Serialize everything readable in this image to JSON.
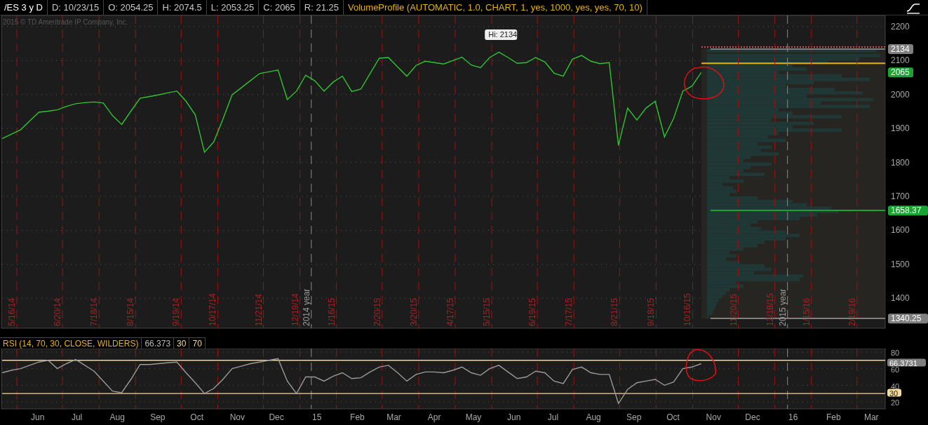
{
  "header": {
    "fields": [
      {
        "kind": "symbol",
        "text": "/ES 3 y D"
      },
      {
        "kind": "field",
        "text": "D: 10/23/15"
      },
      {
        "kind": "field",
        "text": "O: 2054.25"
      },
      {
        "kind": "field",
        "text": "H: 2074.5"
      },
      {
        "kind": "field",
        "text": "L: 2053.25"
      },
      {
        "kind": "field",
        "text": "C: 2065"
      },
      {
        "kind": "field",
        "text": "R: 21.25"
      },
      {
        "kind": "study",
        "text": "VolumeProfile (AUTOMATIC, 1.0, CHART, 1, yes, 1000, yes, yes, 70, 10)"
      }
    ]
  },
  "copyright": "2015 © TD Ameritrade IP Company, Inc.",
  "high_label": "Hi: 2134",
  "period_markers": [
    {
      "kind": "period",
      "label": "5/16/14"
    },
    {
      "kind": "period",
      "label": "6/20/14"
    },
    {
      "kind": "period",
      "label": "7/18/14"
    },
    {
      "kind": "period",
      "label": "8/15/14"
    },
    {
      "kind": "period",
      "label": "9/19/14"
    },
    {
      "kind": "period",
      "label": "10/17/14"
    },
    {
      "kind": "period",
      "label": "11/21/14"
    },
    {
      "kind": "period",
      "label": "12/19/14"
    },
    {
      "kind": "year",
      "label": "2014 year"
    },
    {
      "kind": "period",
      "label": "1/16/15"
    },
    {
      "kind": "period",
      "label": "2/20/15"
    },
    {
      "kind": "period",
      "label": "3/20/15"
    },
    {
      "kind": "period",
      "label": "4/17/15"
    },
    {
      "kind": "period",
      "label": "5/15/15"
    },
    {
      "kind": "period",
      "label": "6/19/15"
    },
    {
      "kind": "period",
      "label": "7/17/15"
    },
    {
      "kind": "period",
      "label": "8/21/15"
    },
    {
      "kind": "period",
      "label": "9/18/15"
    },
    {
      "kind": "period",
      "label": "10/16/15"
    },
    {
      "kind": "period",
      "label": "11/20/15"
    },
    {
      "kind": "period",
      "label": "12/18/15"
    },
    {
      "kind": "year",
      "label": "2015 year"
    },
    {
      "kind": "period",
      "label": "1/15/16"
    },
    {
      "kind": "period",
      "label": "2/19/16"
    }
  ],
  "price_levels": [
    {
      "label": "2134",
      "color": "#7f7f7f"
    },
    {
      "label": "2065",
      "color": "#1aa532"
    },
    {
      "label": "1658.37",
      "color": "#1aa532"
    },
    {
      "label": "1340.25",
      "color": "#7f7f7f"
    }
  ],
  "price_chart": {
    "chart_data": {
      "type": "line",
      "grid": true,
      "ylim": [
        1311.6,
        2233
      ],
      "yticks": [
        1400,
        1500,
        1600,
        1700,
        1800,
        1900,
        2000,
        2100,
        2200
      ],
      "series": [
        {
          "color": "#2fc42f",
          "values": [
            1870,
            1883,
            1896,
            1922,
            1948,
            1951,
            1955,
            1965,
            1973,
            1976,
            1978,
            1975,
            1938,
            1912,
            1951,
            1989,
            1994,
            1999,
            2005,
            2010,
            1980,
            1940,
            1830,
            1860,
            1927,
            1999,
            2020,
            2041,
            2062,
            2067,
            2072,
            1985,
            2010,
            2057,
            2040,
            2010,
            2037,
            2054,
            2009,
            2016,
            2062,
            2107,
            2109,
            2081,
            2054,
            2086,
            2098,
            2094,
            2090,
            2100,
            2110,
            2087,
            2079,
            2109,
            2125,
            2109,
            2092,
            2094,
            2109,
            2096,
            2063,
            2054,
            2104,
            2115,
            2098,
            2091,
            2094,
            1850,
            1960,
            1925,
            1960,
            1980,
            1875,
            1930,
            2010,
            2025,
            2065,
            null,
            null,
            null,
            null,
            null,
            null,
            null,
            null,
            null,
            null,
            null,
            null,
            null,
            null,
            null,
            null,
            null,
            null,
            null,
            null
          ]
        },
        {
          "color": "#7f7f7f",
          "values": [
            null,
            null,
            null,
            null,
            null,
            null,
            null,
            null,
            null,
            null,
            null,
            null,
            null,
            null,
            null,
            null,
            null,
            null,
            null,
            null,
            null,
            null,
            null,
            null,
            null,
            null,
            null,
            null,
            null,
            null,
            null,
            null,
            null,
            null,
            null,
            null,
            null,
            null,
            null,
            null,
            null,
            null,
            null,
            null,
            null,
            null,
            null,
            null,
            null,
            null,
            null,
            null,
            null,
            null,
            null,
            null,
            null,
            null,
            null,
            null,
            null,
            null,
            null,
            null,
            null,
            null,
            null,
            null,
            null,
            null,
            null,
            null,
            null,
            null,
            null,
            null,
            null,
            2134,
            2134,
            2134,
            2134,
            2134,
            2134,
            2134,
            2134,
            2134,
            2134,
            2134,
            2134,
            2134,
            2134,
            2134,
            2134,
            2134,
            2134,
            2134,
            2134
          ]
        },
        {
          "color": "#1aa532",
          "values": [
            null,
            null,
            null,
            null,
            null,
            null,
            null,
            null,
            null,
            null,
            null,
            null,
            null,
            null,
            null,
            null,
            null,
            null,
            null,
            null,
            null,
            null,
            null,
            null,
            null,
            null,
            null,
            null,
            null,
            null,
            null,
            null,
            null,
            null,
            null,
            null,
            null,
            null,
            null,
            null,
            null,
            null,
            null,
            null,
            null,
            null,
            null,
            null,
            null,
            null,
            null,
            null,
            null,
            null,
            null,
            null,
            null,
            null,
            null,
            null,
            null,
            null,
            null,
            null,
            null,
            null,
            null,
            null,
            null,
            null,
            null,
            null,
            null,
            null,
            null,
            null,
            null,
            1658.37,
            1658.37,
            1658.37,
            1658.37,
            1658.37,
            1658.37,
            1658.37,
            1658.37,
            1658.37,
            1658.37,
            1658.37,
            1658.37,
            1658.37,
            1658.37,
            1658.37,
            1658.37,
            1658.37,
            1658.37,
            1658.37,
            1658.37
          ]
        },
        {
          "color": "#7f7f7f",
          "values": [
            null,
            null,
            null,
            null,
            null,
            null,
            null,
            null,
            null,
            null,
            null,
            null,
            null,
            null,
            null,
            null,
            null,
            null,
            null,
            null,
            null,
            null,
            null,
            null,
            null,
            null,
            null,
            null,
            null,
            null,
            null,
            null,
            null,
            null,
            null,
            null,
            null,
            null,
            null,
            null,
            null,
            null,
            null,
            null,
            null,
            null,
            null,
            null,
            null,
            null,
            null,
            null,
            null,
            null,
            null,
            null,
            null,
            null,
            null,
            null,
            null,
            null,
            null,
            null,
            null,
            null,
            null,
            null,
            null,
            null,
            null,
            null,
            null,
            null,
            null,
            null,
            null,
            1340.25,
            1340.25,
            1340.25,
            1340.25,
            1340.25,
            1340.25,
            1340.25,
            1340.25,
            1340.25,
            1340.25,
            1340.25,
            1340.25,
            1340.25,
            1340.25,
            1340.25,
            1340.25,
            1340.25,
            1340.25,
            1340.25,
            1340.25
          ]
        }
      ]
    }
  },
  "rsi": {
    "header": [
      {
        "kind": "study",
        "text": "RSI (14, 70, 30, CLOSE, WILDERS)"
      },
      {
        "kind": "value",
        "text": "66.373"
      },
      {
        "kind": "threshold",
        "text": "30"
      },
      {
        "kind": "threshold",
        "text": "70"
      }
    ],
    "levels": [
      {
        "label": "66.3731",
        "color": "#7f7f7f"
      },
      {
        "label": "30",
        "color": "#f3dc9a"
      }
    ],
    "month_labels": [
      "Jun",
      "Jul",
      "Aug",
      "Sep",
      "Oct",
      "Nov",
      "Dec",
      "15",
      "Feb",
      "Mar",
      "Apr",
      "May",
      "Jun",
      "Jul",
      "Aug",
      "Sep",
      "Oct",
      "Nov",
      "Dec",
      "16",
      "Feb",
      "Mar"
    ],
    "chart_data": {
      "type": "line",
      "grid": true,
      "ylim": [
        11.5,
        84.2
      ],
      "yticks": [
        20,
        40,
        60,
        80
      ],
      "series": [
        {
          "color": "#efd890",
          "values": [
            70,
            70,
            70,
            70,
            70,
            70,
            70,
            70,
            70,
            70,
            70,
            70,
            70,
            70,
            70,
            70,
            70,
            70,
            70,
            70,
            70,
            70,
            70,
            70,
            70,
            70,
            70,
            70,
            70,
            70,
            70,
            70,
            70,
            70,
            70,
            70,
            70,
            70,
            70,
            70,
            70,
            70,
            70,
            70,
            70,
            70,
            70,
            70,
            70,
            70,
            70,
            70,
            70,
            70,
            70,
            70,
            70,
            70,
            70,
            70,
            70,
            70,
            70,
            70,
            70,
            70,
            70,
            70,
            70,
            70,
            70,
            70,
            70,
            70,
            70,
            70,
            70,
            70,
            70,
            70,
            70,
            70,
            70,
            70,
            70,
            70,
            70,
            70,
            70,
            70,
            70,
            70,
            70,
            70,
            70,
            70,
            70
          ]
        },
        {
          "color": "#efd890",
          "values": [
            30,
            30,
            30,
            30,
            30,
            30,
            30,
            30,
            30,
            30,
            30,
            30,
            30,
            30,
            30,
            30,
            30,
            30,
            30,
            30,
            30,
            30,
            30,
            30,
            30,
            30,
            30,
            30,
            30,
            30,
            30,
            30,
            30,
            30,
            30,
            30,
            30,
            30,
            30,
            30,
            30,
            30,
            30,
            30,
            30,
            30,
            30,
            30,
            30,
            30,
            30,
            30,
            30,
            30,
            30,
            30,
            30,
            30,
            30,
            30,
            30,
            30,
            30,
            30,
            30,
            30,
            30,
            30,
            30,
            30,
            30,
            30,
            30,
            30,
            30,
            30,
            30,
            30,
            30,
            30,
            30,
            30,
            30,
            30,
            30,
            30,
            30,
            30,
            30,
            30,
            30,
            30,
            30,
            30,
            30,
            30,
            30
          ]
        },
        {
          "color": "#9a9a9a",
          "values": [
            55,
            58,
            60,
            64,
            68,
            70,
            60,
            66,
            71,
            64,
            57,
            45,
            33,
            31,
            47,
            65,
            65,
            66,
            67,
            68,
            55,
            43,
            30,
            36,
            47,
            60,
            63,
            66,
            68,
            70,
            72,
            45,
            30,
            50,
            50,
            45,
            51,
            55,
            48,
            49,
            56,
            62,
            64,
            55,
            45,
            53,
            56,
            56,
            55,
            58,
            62,
            55,
            52,
            60,
            64,
            56,
            48,
            50,
            57,
            55,
            45,
            42,
            59,
            62,
            55,
            53,
            53,
            18,
            35,
            43,
            45,
            47,
            40,
            44,
            60,
            62,
            66,
            null,
            null,
            null,
            null,
            null,
            null,
            null,
            null,
            null,
            null,
            null,
            null,
            null,
            null,
            null,
            null,
            null,
            null,
            null,
            null
          ]
        }
      ]
    }
  }
}
